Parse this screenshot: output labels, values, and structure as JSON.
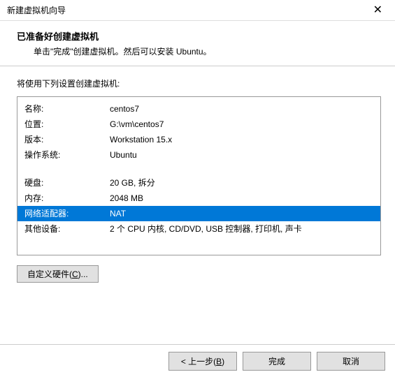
{
  "titlebar": {
    "title": "新建虚拟机向导"
  },
  "header": {
    "title": "已准备好创建虚拟机",
    "subtitle": "单击\"完成\"创建虚拟机。然后可以安装 Ubuntu。"
  },
  "content": {
    "label": "将使用下列设置创建虚拟机:",
    "rows": {
      "name_label": "名称:",
      "name_value": "centos7",
      "location_label": "位置:",
      "location_value": "G:\\vm\\centos7",
      "version_label": "版本:",
      "version_value": "Workstation 15.x",
      "os_label": "操作系统:",
      "os_value": "Ubuntu",
      "disk_label": "硬盘:",
      "disk_value": "20 GB, 拆分",
      "memory_label": "内存:",
      "memory_value": "2048 MB",
      "network_label": "网络适配器:",
      "network_value": "NAT",
      "other_label": "其他设备:",
      "other_value": "2 个 CPU 内核, CD/DVD, USB 控制器, 打印机, 声卡"
    },
    "customize_btn": "自定义硬件(C)..."
  },
  "footer": {
    "back": "< 上一步(B)",
    "finish": "完成",
    "cancel": "取消"
  }
}
